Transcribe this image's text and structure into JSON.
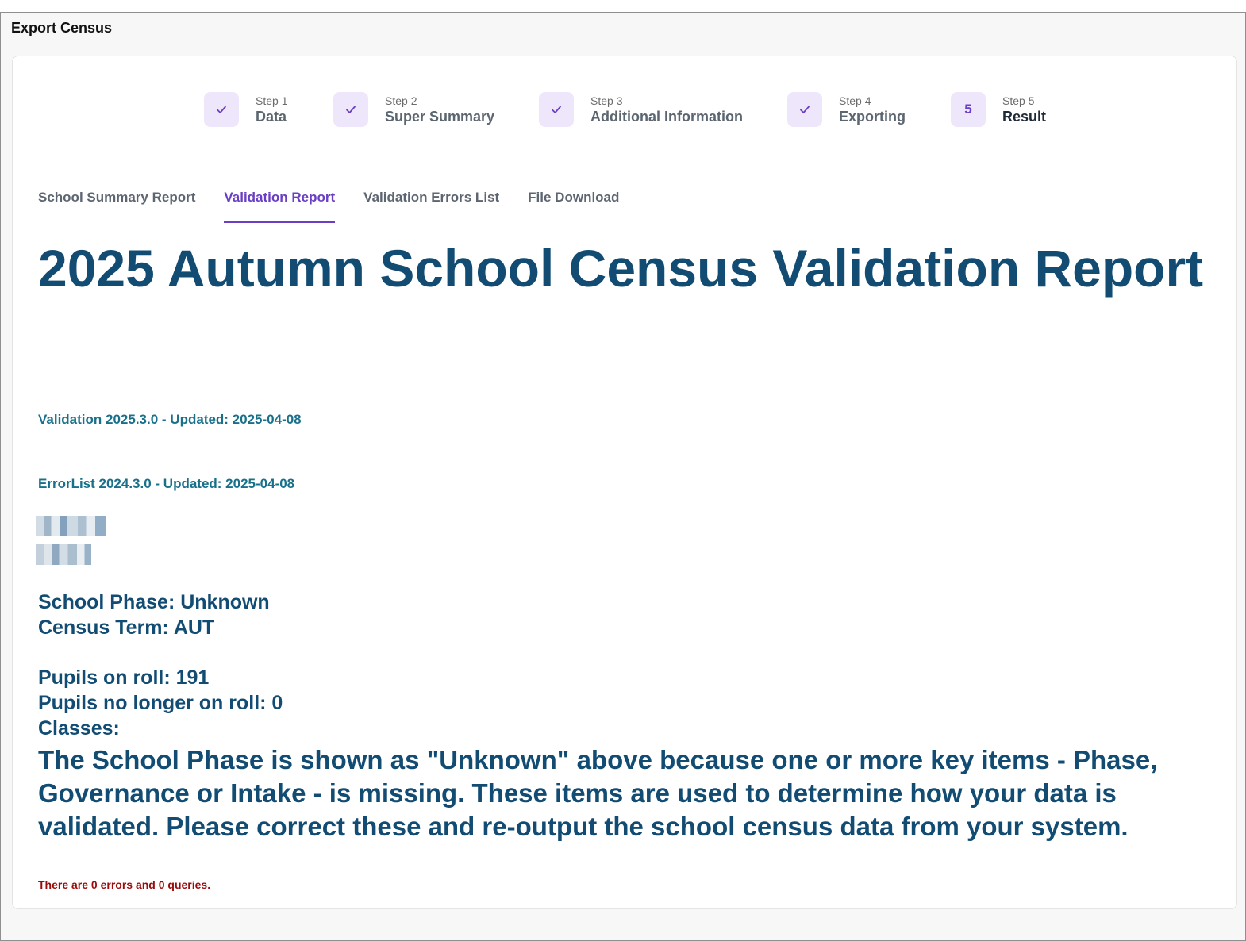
{
  "window": {
    "title": "Export Census"
  },
  "steps": [
    {
      "number_label": "Step 1",
      "name": "Data",
      "status": "done",
      "badge": ""
    },
    {
      "number_label": "Step 2",
      "name": "Super Summary",
      "status": "done",
      "badge": ""
    },
    {
      "number_label": "Step 3",
      "name": "Additional Information",
      "status": "done",
      "badge": ""
    },
    {
      "number_label": "Step 4",
      "name": "Exporting",
      "status": "done",
      "badge": ""
    },
    {
      "number_label": "Step 5",
      "name": "Result",
      "status": "active",
      "badge": "5"
    }
  ],
  "tabs": [
    {
      "label": "School Summary Report",
      "active": false
    },
    {
      "label": "Validation Report",
      "active": true
    },
    {
      "label": "Validation Errors List",
      "active": false
    },
    {
      "label": "File Download",
      "active": false
    }
  ],
  "report": {
    "title": "2025 Autumn School Census Validation Report",
    "validation_version": "Validation 2025.3.0 - Updated: 2025-04-08",
    "errorlist_version": "ErrorList 2024.3.0 - Updated: 2025-04-08",
    "school_phase": "School Phase: Unknown",
    "census_term": "Census Term: AUT",
    "pupils_on_roll": "Pupils on roll: 191",
    "pupils_no_longer_on_roll": "Pupils no longer on roll: 0",
    "classes": "Classes:",
    "notice": "The School Phase is shown as \"Unknown\" above because one or more key items - Phase, Governance or Intake - is missing. These items are used to determine how your data is validated. Please correct these and re-output the school census data from your system.",
    "summary": "There are 0 errors and 0 queries."
  },
  "colors": {
    "accent": "#6a3fc3",
    "report_text": "#124c73",
    "version_text": "#18708a",
    "error_text": "#9b0b0b"
  }
}
